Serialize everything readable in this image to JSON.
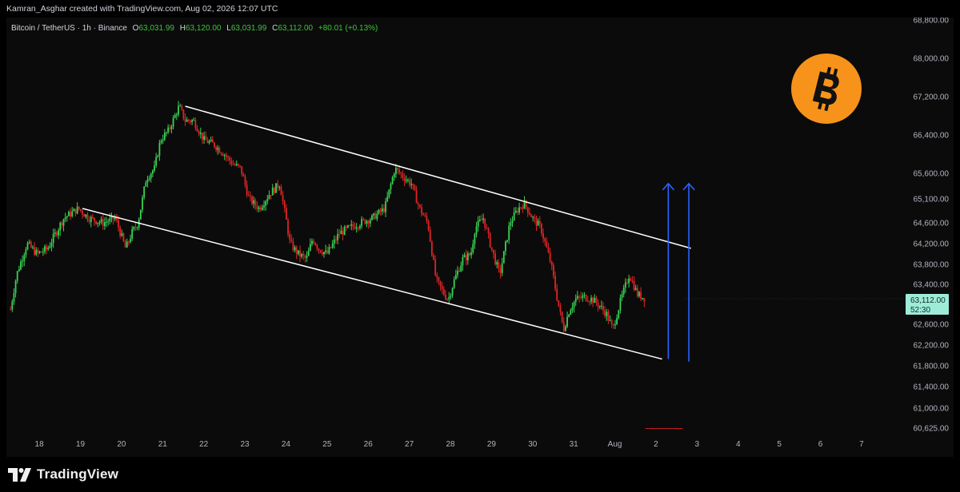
{
  "header": {
    "credit": "Kamran_Asghar created with TradingView.com, Aug 02, 2026 12:07 UTC"
  },
  "legend": {
    "symbol": "Bitcoin / TetherUS · 1h · Binance",
    "open_prefix": "O",
    "open": "63,031.99",
    "high_prefix": "H",
    "high": "63,120.00",
    "low_prefix": "L",
    "low": "63,031.99",
    "close_prefix": "C",
    "close": "63,112.00",
    "change": "+80.01 (+0.13%)"
  },
  "price_tag": {
    "price": "63,112.00",
    "countdown": "52:30",
    "value": 63112
  },
  "footer": {
    "brand": "TradingView"
  },
  "colors": {
    "up": "#26a69a",
    "up_candle": "#39d353",
    "down_candle": "#e02424",
    "channel": "#ffffff",
    "arrows": "#2962ff",
    "bitcoin_logo": "#f7931a",
    "legend_value": "#3cc43c",
    "axis_text": "#b2b5be",
    "tag_bg": "#9eebd8"
  },
  "chart_data": {
    "type": "candlestick",
    "title": "Bitcoin / TetherUS · 1h · Binance",
    "x_tick_labels": [
      "18",
      "19",
      "20",
      "21",
      "22",
      "23",
      "24",
      "25",
      "26",
      "27",
      "28",
      "29",
      "30",
      "31",
      "Aug",
      "2",
      "3",
      "4",
      "5",
      "6",
      "7"
    ],
    "y_tick_labels": [
      "68,800.00",
      "68,000.00",
      "67,200.00",
      "66,400.00",
      "65,600.00",
      "65,100.00",
      "64,600.00",
      "64,200.00",
      "63,800.00",
      "63,400.00",
      "62,600.00",
      "62,200.00",
      "61,800.00",
      "61,400.00",
      "61,000.00",
      "60,625.00"
    ],
    "y_tick_values": [
      68800,
      68000,
      67200,
      66400,
      65600,
      65100,
      64600,
      64200,
      63800,
      63400,
      62600,
      62200,
      61800,
      61400,
      61000,
      60625
    ],
    "series": [
      {
        "kind": "close_path",
        "x": [
          17.3,
          17.45,
          17.7,
          17.95,
          18.2,
          18.6,
          18.95,
          19.2,
          19.55,
          19.85,
          20.1,
          20.25,
          20.4,
          20.6,
          20.8,
          20.95,
          21.15,
          21.4,
          21.55,
          21.75,
          22.0,
          22.25,
          22.5,
          22.7,
          22.9,
          23.1,
          23.35,
          23.6,
          23.85,
          24.1,
          24.3,
          24.5,
          24.65,
          24.8,
          25.0,
          25.3,
          25.55,
          25.8,
          26.1,
          26.4,
          26.65,
          26.9,
          27.05,
          27.25,
          27.45,
          27.65,
          27.85,
          27.95,
          28.1,
          28.3,
          28.5,
          28.6,
          28.8,
          29.0,
          29.2,
          29.45,
          29.65,
          29.8,
          30.0,
          30.2,
          30.45,
          30.6,
          30.75,
          30.9,
          31.05,
          31.25,
          31.45,
          31.6,
          31.8,
          31.95,
          32.15,
          32.35,
          32.55,
          32.75,
          32.9,
          33.1,
          33.3,
          33.45,
          33.55,
          33.65
        ],
        "close": [
          62900,
          63600,
          64200,
          64000,
          64100,
          64700,
          64900,
          64700,
          64600,
          64700,
          64100,
          64400,
          64600,
          65500,
          65700,
          66300,
          66500,
          67000,
          66700,
          66700,
          66300,
          66200,
          66000,
          65800,
          65700,
          65100,
          64900,
          65200,
          65400,
          64200,
          64000,
          63900,
          64300,
          64100,
          64000,
          64400,
          64500,
          64600,
          64700,
          64900,
          65700,
          65500,
          65400,
          64900,
          64600,
          63500,
          63200,
          63100,
          63500,
          63900,
          64000,
          64500,
          64700,
          64100,
          63600,
          64600,
          64900,
          65000,
          64700,
          64500,
          63800,
          63100,
          62500,
          62900,
          63100,
          63150,
          63100,
          63000,
          62800,
          62500,
          63100,
          63600,
          63200,
          63112
        ]
      },
      {
        "kind": "channel_upper",
        "x": [
          21.55,
          33.85
        ],
        "y": [
          67000,
          64110
        ]
      },
      {
        "kind": "channel_lower",
        "x": [
          19.05,
          33.15
        ],
        "y": [
          64900,
          61930
        ]
      },
      {
        "kind": "projection_arrows",
        "x": [
          33.3,
          33.8
        ],
        "from": [
          61930,
          61880
        ],
        "to": [
          65400,
          65400
        ]
      }
    ],
    "last_price": 63112,
    "xlim": [
      17.2,
      38.8
    ],
    "ylim": [
      60580,
      68900
    ],
    "grid": false,
    "y_axis": "right"
  }
}
